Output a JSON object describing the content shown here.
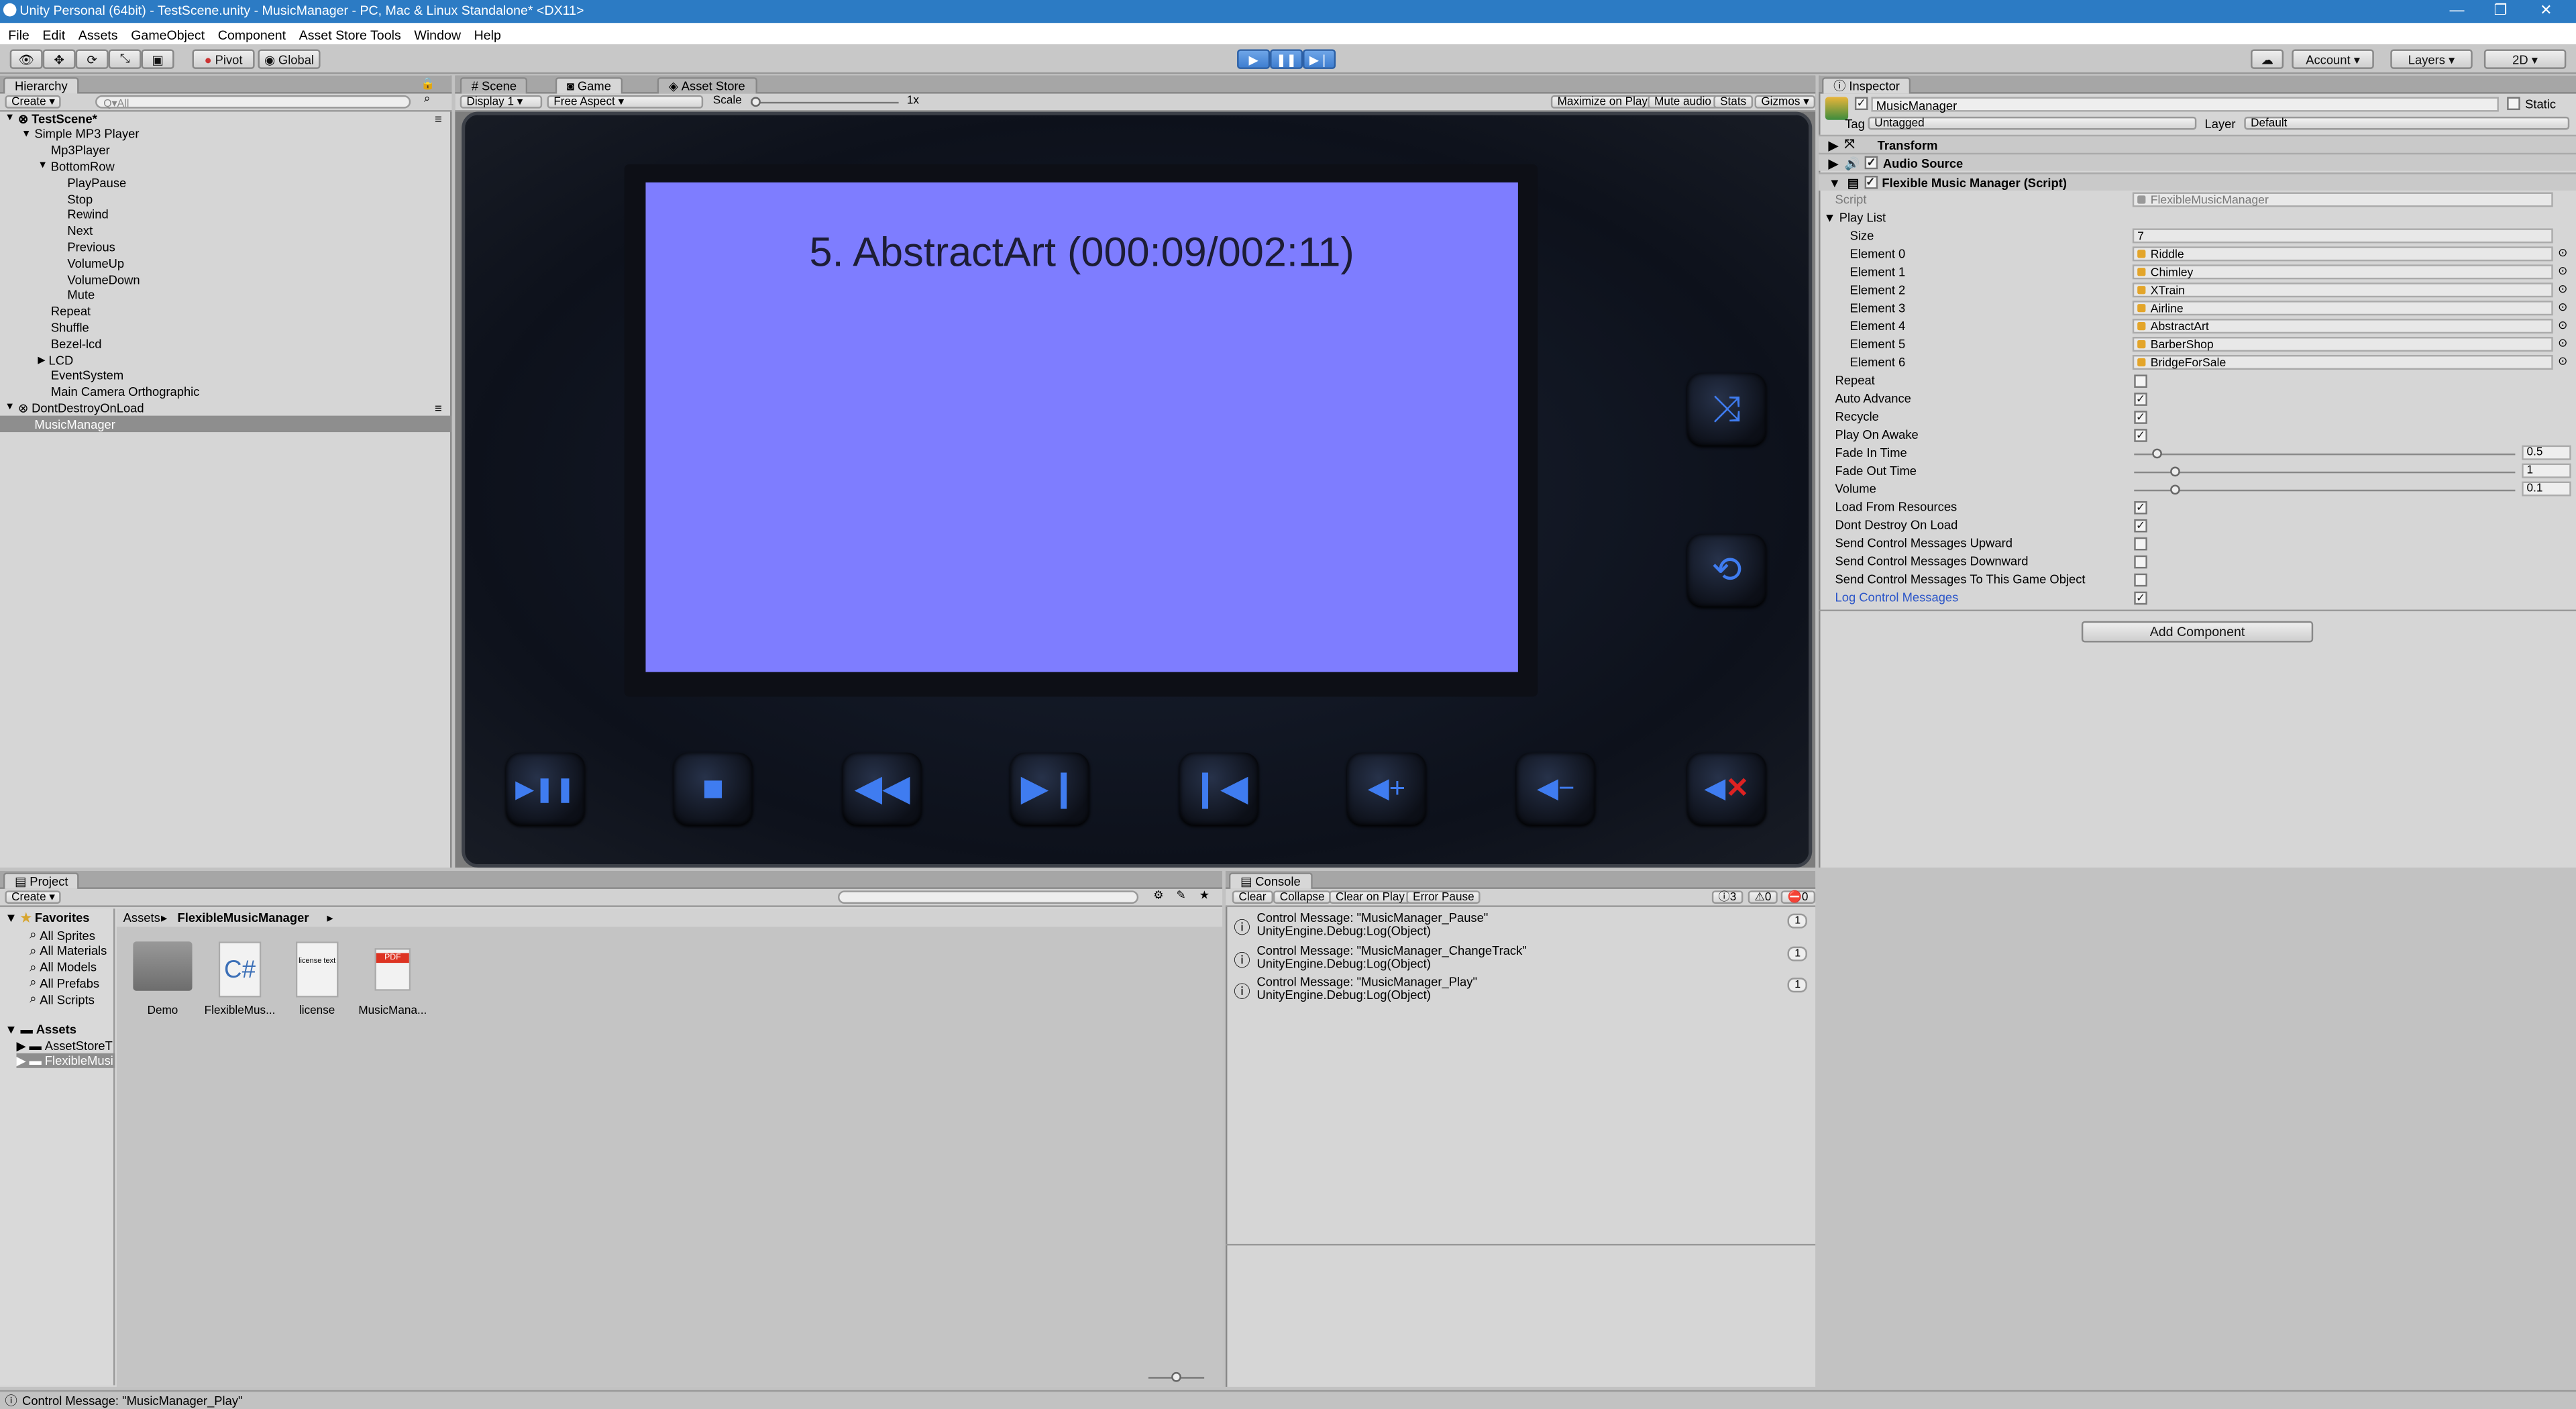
{
  "window": {
    "title": "Unity Personal (64bit) - TestScene.unity - MusicManager - PC, Mac & Linux Standalone* <DX11>"
  },
  "menu": [
    "File",
    "Edit",
    "Assets",
    "GameObject",
    "Component",
    "Asset Store Tools",
    "Window",
    "Help"
  ],
  "toolbar": {
    "pivot": "Pivot",
    "global": "Global",
    "account": "Account",
    "layers": "Layers",
    "layout": "2D"
  },
  "hierarchy": {
    "tab": "Hierarchy",
    "create": "Create",
    "search_placeholder": "Q▾All",
    "rows": [
      {
        "label": "TestScene*",
        "indent": 0,
        "bold": true,
        "arrow": "▼"
      },
      {
        "label": "Simple MP3 Player",
        "indent": 1,
        "arrow": "▼"
      },
      {
        "label": "Mp3Player",
        "indent": 2
      },
      {
        "label": "BottomRow",
        "indent": 2,
        "arrow": "▼"
      },
      {
        "label": "PlayPause",
        "indent": 3
      },
      {
        "label": "Stop",
        "indent": 3
      },
      {
        "label": "Rewind",
        "indent": 3
      },
      {
        "label": "Next",
        "indent": 3
      },
      {
        "label": "Previous",
        "indent": 3
      },
      {
        "label": "VolumeUp",
        "indent": 3
      },
      {
        "label": "VolumeDown",
        "indent": 3
      },
      {
        "label": "Mute",
        "indent": 3
      },
      {
        "label": "Repeat",
        "indent": 2
      },
      {
        "label": "Shuffle",
        "indent": 2
      },
      {
        "label": "Bezel-lcd",
        "indent": 2
      },
      {
        "label": "LCD",
        "indent": 2,
        "arrow": "▶"
      },
      {
        "label": "EventSystem",
        "indent": 2
      },
      {
        "label": "Main Camera Orthographic",
        "indent": 2
      },
      {
        "label": "DontDestroyOnLoad",
        "indent": 0,
        "arrow": "▼",
        "scene": true
      },
      {
        "label": "MusicManager",
        "indent": 1,
        "selected": true
      }
    ]
  },
  "game": {
    "tabs": [
      "Scene",
      "Game",
      "Asset Store"
    ],
    "display": "Display 1",
    "aspect": "Free Aspect",
    "scale_label": "Scale",
    "scale_value": "1x",
    "toggles": [
      "Maximize on Play",
      "Mute audio",
      "Stats",
      "Gizmos"
    ],
    "now_playing": "5.  AbstractArt (000:09/002:11)"
  },
  "inspector": {
    "tab": "Inspector",
    "object_name": "MusicManager",
    "static": "Static",
    "tag_label": "Tag",
    "tag_value": "Untagged",
    "layer_label": "Layer",
    "layer_value": "Default",
    "components": [
      "Transform",
      "Audio Source",
      "Flexible Music Manager (Script)"
    ],
    "script_label": "Script",
    "script_value": "FlexibleMusicManager",
    "playlist_label": "Play List",
    "size_label": "Size",
    "size_value": "7",
    "elements": [
      {
        "label": "Element 0",
        "value": "Riddle"
      },
      {
        "label": "Element 1",
        "value": "Chimley"
      },
      {
        "label": "Element 2",
        "value": "XTrain"
      },
      {
        "label": "Element 3",
        "value": "Airline"
      },
      {
        "label": "Element 4",
        "value": "AbstractArt"
      },
      {
        "label": "Element 5",
        "value": "BarberShop"
      },
      {
        "label": "Element 6",
        "value": "BridgeForSale"
      }
    ],
    "repeat": "Repeat",
    "auto_advance": "Auto Advance",
    "recycle": "Recycle",
    "play_on_awake": "Play On Awake",
    "fade_in": "Fade In Time",
    "fade_in_value": "0.5",
    "fade_out": "Fade Out Time",
    "fade_out_value": "1",
    "volume": "Volume",
    "volume_value": "0.1",
    "load_res": "Load From Resources",
    "dont_destroy": "Dont Destroy On Load",
    "send_up": "Send Control Messages Upward",
    "send_down": "Send Control Messages Downward",
    "send_self": "Send Control Messages To This Game Object",
    "log_msgs": "Log Control Messages",
    "add_component": "Add Component"
  },
  "project": {
    "tab": "Project",
    "create": "Create",
    "favorites": "Favorites",
    "fav_items": [
      "All Sprites",
      "All Materials",
      "All Models",
      "All Prefabs",
      "All Scripts"
    ],
    "assets": "Assets",
    "asset_children": [
      "AssetStoreT",
      "FlexibleMusi"
    ],
    "breadcrumb_root": "Assets",
    "breadcrumb_leaf": "FlexibleMusicManager",
    "items": [
      "Demo",
      "FlexibleMus...",
      "license",
      "MusicMana..."
    ],
    "license_preview": "license text",
    "pdf_badge": "PDF"
  },
  "console": {
    "tab": "Console",
    "buttons": [
      "Clear",
      "Collapse",
      "Clear on Play",
      "Error Pause"
    ],
    "counts": [
      "3",
      "0",
      "0"
    ],
    "rows": [
      {
        "line1": "Control Message: \"MusicManager_Pause\"",
        "line2": "UnityEngine.Debug:Log(Object)",
        "count": "1"
      },
      {
        "line1": "Control Message: \"MusicManager_ChangeTrack\"",
        "line2": "UnityEngine.Debug:Log(Object)",
        "count": "1"
      },
      {
        "line1": "Control Message: \"MusicManager_Play\"",
        "line2": "UnityEngine.Debug:Log(Object)",
        "count": "1"
      }
    ]
  },
  "status": "Control Message: \"MusicManager_Play\""
}
